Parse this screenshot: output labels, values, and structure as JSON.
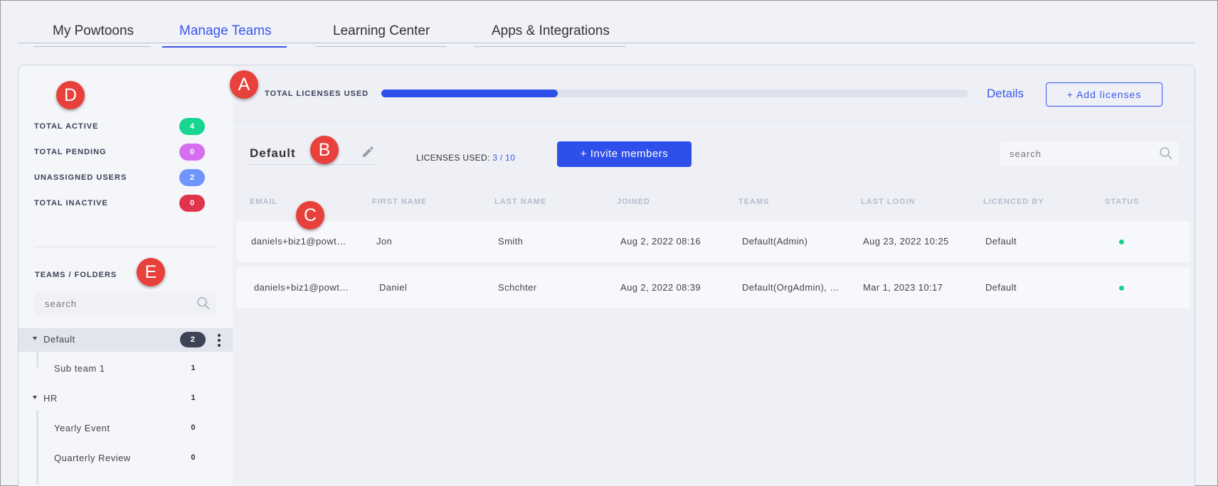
{
  "nav": {
    "tabs": [
      {
        "label": "My Powtoons"
      },
      {
        "label": "Manage Teams"
      },
      {
        "label": "Learning Center"
      },
      {
        "label": "Apps & Integrations"
      }
    ]
  },
  "sidebar": {
    "stats": [
      {
        "label": "TOTAL ACTIVE",
        "count": "4",
        "color": "#17d690"
      },
      {
        "label": "TOTAL PENDING",
        "count": "0",
        "color": "#d56ff0"
      },
      {
        "label": "UNASSIGNED USERS",
        "count": "2",
        "color": "#6f95ff"
      },
      {
        "label": "TOTAL INACTIVE",
        "count": "0",
        "color": "#e0334c"
      }
    ],
    "teams_heading": "TEAMS / FOLDERS",
    "search_placeholder": "search",
    "tree": [
      {
        "name": "Default",
        "count": "2",
        "selected": true,
        "level": 0
      },
      {
        "name": "Sub team 1",
        "count": "1",
        "level": 1
      },
      {
        "name": "HR",
        "count": "1",
        "level": 0
      },
      {
        "name": "Yearly Event",
        "count": "0",
        "level": 1
      },
      {
        "name": "Quarterly Review",
        "count": "0",
        "level": 1
      }
    ]
  },
  "licenses": {
    "label": "TOTAL LICENSES USED",
    "progress": 0.3,
    "details_label": "Details",
    "add_label": "+   Add licenses"
  },
  "team": {
    "name": "Default",
    "licenses_used_label": "LICENSES USED:",
    "licenses_used_value": "3 / 10",
    "invite_label": "+    Invite members",
    "search_placeholder": "search"
  },
  "table": {
    "headers": [
      "EMAIL",
      "FIRST NAME",
      "LAST NAME",
      "JOINED",
      "TEAMS",
      "LAST LOGIN",
      "LICENCED BY",
      "STATUS"
    ],
    "rows": [
      {
        "email": "daniels+biz1@powt…",
        "first": "Jon",
        "last": "Smith",
        "joined": "Aug 2, 2022 08:16",
        "teams": "Default(Admin)",
        "last_login": "Aug 23, 2022 10:25",
        "licenced_by": "Default",
        "status_color": "#1bd28a"
      },
      {
        "email": "daniels+biz1@powt…",
        "first": "Daniel",
        "last": "Schchter",
        "joined": "Aug 2, 2022 08:39",
        "teams": "Default(OrgAdmin), …",
        "last_login": "Mar 1, 2023 10:17",
        "licenced_by": "Default",
        "status_color": "#1bd28a"
      }
    ]
  },
  "markers": [
    "A",
    "B",
    "C",
    "D",
    "E"
  ]
}
